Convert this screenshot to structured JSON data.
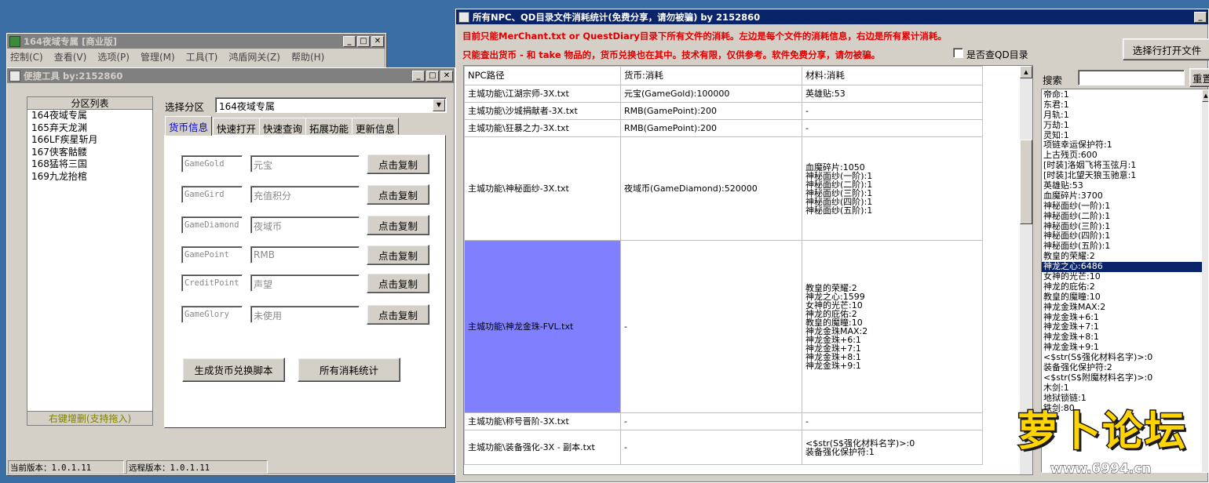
{
  "main_window": {
    "title": "164夜域专属 [商业版]",
    "menu": [
      "控制(C)",
      "查看(V)",
      "选项(P)",
      "管理(M)",
      "工具(T)",
      "鸿盾网关(Z)",
      "帮助(H)"
    ]
  },
  "tool_window": {
    "title": "便捷工具   by:2152860",
    "region_list_title": "分区列表",
    "regions": [
      "164夜域专属",
      "165弃天龙渊",
      "166LF疾星斩月",
      "167侠客骷髅",
      "168猛将三国",
      "169九龙抬棺"
    ],
    "region_footer": "右键增删(支持拖入)",
    "select_label": "选择分区",
    "select_value": "164夜域专属",
    "tabs": [
      "货币信息",
      "快速打开",
      "快速查询",
      "拓展功能",
      "更新信息"
    ],
    "currency_rows": [
      {
        "code": "GameGold",
        "name": "元宝",
        "button": "点击复制"
      },
      {
        "code": "GameGird",
        "name": "充值积分",
        "button": "点击复制"
      },
      {
        "code": "GameDiamond",
        "name": "夜域币",
        "button": "点击复制"
      },
      {
        "code": "GamePoint",
        "name": "RMB",
        "button": "点击复制"
      },
      {
        "code": "CreditPoint",
        "name": "声望",
        "button": "点击复制"
      },
      {
        "code": "GameGlory",
        "name": "未使用",
        "button": "点击复制"
      }
    ],
    "gen_script_button": "生成货币兑换脚本",
    "all_stats_button": "所有消耗统计",
    "current_version": "当前版本：1.0.1.11",
    "remote_version": "远程版本：1.0.1.11"
  },
  "stats_window": {
    "title": "所有NPC、QD目录文件消耗统计(免费分享，请勿被骗)      by 2152860",
    "notice1": "目前只能MerChant.txt or QuestDiary目录下所有文件的消耗。左边是每个文件的消耗信息，右边是所有累计消耗。",
    "notice2": "只能查出货币 - 和 take 物品的，货币兑换也在其中。技术有限，仅供参考。软件免费分享，请勿被骗。",
    "qd_checkbox": "是否查QD目录",
    "select_open_button": "选择行打开文件",
    "search_label": "搜索",
    "reset_button": "重置",
    "headers": [
      "NPC路径",
      "货币:消耗",
      "材料:消耗"
    ],
    "rows": [
      {
        "path": "主城功能\\江湖宗师-3X.txt",
        "currency": "元宝(GameGold):100000",
        "materials": [
          "英雄贴:53"
        ]
      },
      {
        "path": "主城功能\\沙城捐献者-3X.txt",
        "currency": "RMB(GamePoint):200",
        "materials": [
          "-"
        ]
      },
      {
        "path": "主城功能\\狂暴之力-3X.txt",
        "currency": "RMB(GamePoint):200",
        "materials": [
          "-"
        ]
      },
      {
        "path": "主城功能\\神秘面纱-3X.txt",
        "currency": "夜域币(GameDiamond):520000",
        "materials": [
          "血魔碎片:1050",
          "神秘面纱(一阶):1",
          "神秘面纱(二阶):1",
          "神秘面纱(三阶):1",
          "神秘面纱(四阶):1",
          "神秘面纱(五阶):1"
        ]
      },
      {
        "path": "主城功能\\神龙金珠-FVL.txt",
        "currency": "-",
        "materials": [
          "教皇的荣耀:2",
          "神龙之心:1599",
          "女神的光芒:10",
          "神龙的庇佑:2",
          "教皇的魔瞳:10",
          "神龙金珠MAX:2",
          "神龙金珠+6:1",
          "神龙金珠+7:1",
          "神龙金珠+8:1",
          "神龙金珠+9:1"
        ]
      },
      {
        "path": "主城功能\\称号晋阶-3X.txt",
        "currency": "-",
        "materials": [
          "-"
        ]
      },
      {
        "path": "主城功能\\装备强化-3X - 副本.txt",
        "currency": "-",
        "materials": [
          "<$str(S$强化材料名字)>:0",
          "装备强化保护符:1"
        ]
      }
    ],
    "totals": [
      "帝命:1",
      "东君:1",
      "月轨:1",
      "万劫:1",
      "灵知:1",
      "项链幸运保护符:1",
      "上古残页:600",
      "[时装]洛姻飞将玉弦月:1",
      "[时装]北望天狼玉驰意:1",
      "英雄贴:53",
      "血魔碎片:3700",
      "神秘面纱(一阶):1",
      "神秘面纱(二阶):1",
      "神秘面纱(三阶):1",
      "神秘面纱(四阶):1",
      "神秘面纱(五阶):1",
      "教皇的荣耀:2",
      "神龙之心:6486",
      "女神的光芒:10",
      "神龙的庇佑:2",
      "教皇的魔瞳:10",
      "神龙金珠MAX:2",
      "神龙金珠+6:1",
      "神龙金珠+7:1",
      "神龙金珠+8:1",
      "神龙金珠+9:1",
      "<$str(S$强化材料名字)>:0",
      "装备强化保护符:2",
      "<$str(S$附魔材料名字)>:0",
      "木剑:1",
      "地狱锁链:1",
      "铁剑:80"
    ],
    "selected_total_index": 17
  },
  "watermark": {
    "text": "萝卜论坛",
    "url": "www.6994.cn"
  },
  "colors": {
    "desktop": "#3a6ea5",
    "active_title": "#0a246a",
    "inactive_title": "#808080",
    "notice_red": "#e00000",
    "highlight_row": "#8080ff"
  }
}
